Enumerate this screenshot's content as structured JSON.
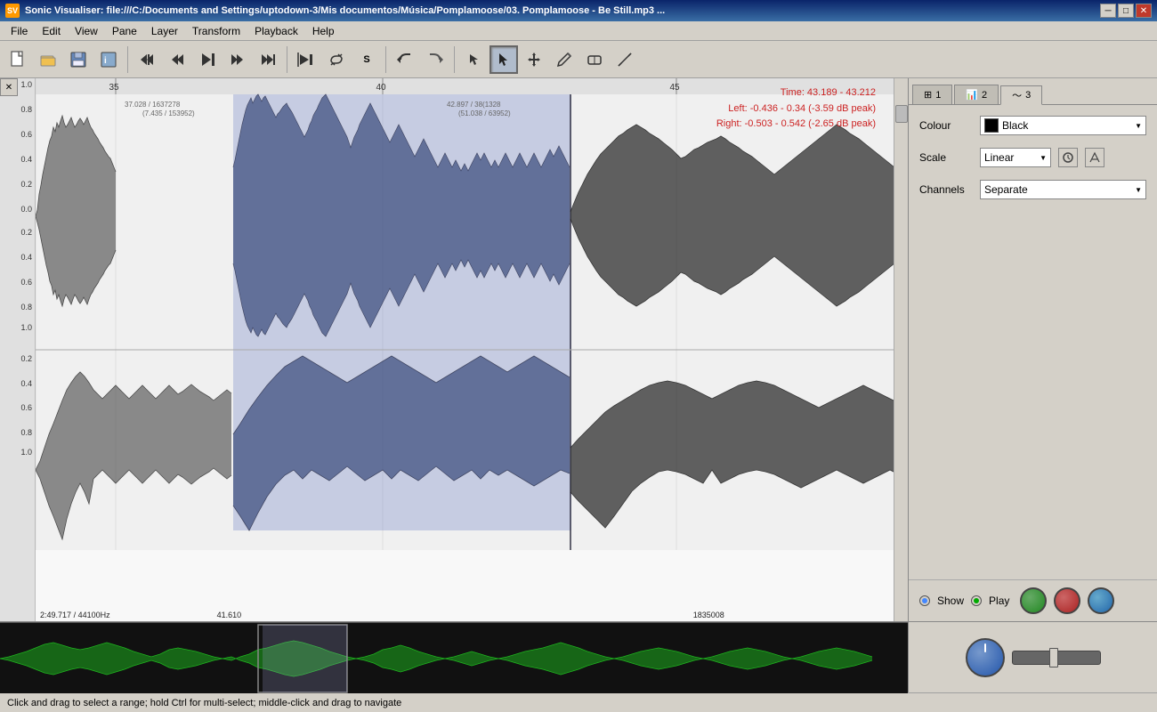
{
  "titleBar": {
    "icon": "SV",
    "title": "Sonic Visualiser: file:///C:/Documents and Settings/uptodown-3/Mis documentos/Música/Pomplamoose/03. Pomplamoose - Be Still.mp3 ...",
    "controls": {
      "minimize": "─",
      "maximize": "□",
      "close": "✕"
    }
  },
  "menuBar": {
    "items": [
      "File",
      "Edit",
      "View",
      "Pane",
      "Layer",
      "Transform",
      "Playback",
      "Help"
    ]
  },
  "toolbar": {
    "buttons": [
      {
        "name": "new",
        "icon": "📄",
        "label": "New"
      },
      {
        "name": "open",
        "icon": "📂",
        "label": "Open"
      },
      {
        "name": "save",
        "icon": "💾",
        "label": "Save"
      },
      {
        "name": "import",
        "icon": "📥",
        "label": "Import"
      },
      {
        "name": "sep1"
      },
      {
        "name": "rewind-start",
        "icon": "⏮",
        "label": "Rewind to Start"
      },
      {
        "name": "rewind",
        "icon": "⏪",
        "label": "Rewind"
      },
      {
        "name": "play-pause",
        "icon": "⏯",
        "label": "Play/Pause"
      },
      {
        "name": "fast-forward",
        "icon": "⏩",
        "label": "Fast Forward"
      },
      {
        "name": "forward-end",
        "icon": "⏭",
        "label": "Forward to End"
      },
      {
        "name": "sep2"
      },
      {
        "name": "play-selection",
        "icon": "▶|",
        "label": "Play Selection"
      },
      {
        "name": "loop",
        "icon": "🔁",
        "label": "Loop"
      },
      {
        "name": "solo",
        "icon": "S",
        "label": "Solo"
      },
      {
        "name": "sep3"
      },
      {
        "name": "undo",
        "icon": "↩",
        "label": "Undo"
      },
      {
        "name": "redo",
        "icon": "↪",
        "label": "Redo"
      },
      {
        "name": "sep4"
      },
      {
        "name": "navigate",
        "icon": "✋",
        "label": "Navigate"
      },
      {
        "name": "select",
        "icon": "↖",
        "label": "Select",
        "active": true
      },
      {
        "name": "move",
        "icon": "✚",
        "label": "Move"
      },
      {
        "name": "draw",
        "icon": "✏",
        "label": "Draw"
      },
      {
        "name": "erase",
        "icon": "◻",
        "label": "Erase"
      },
      {
        "name": "measure",
        "icon": "⚖",
        "label": "Measure"
      }
    ]
  },
  "waveform": {
    "timeInfo": {
      "time": "Time: 43.189 - 43.212",
      "left": "Left: -0.436 - 0.34 (-3.59 dB peak)",
      "right": "Right: -0.503 - 0.542 (-2.65 dB peak)"
    },
    "timeMarkers": [
      "35",
      "40",
      "45"
    ],
    "yLabels": [
      "1.0",
      "0.8",
      "0.6",
      "0.4",
      "0.2",
      "0.0",
      "0.2",
      "0.4",
      "0.6",
      "0.8",
      "1.0",
      "0.2",
      "0.4",
      "0.6",
      "0.8",
      "1.0"
    ],
    "bottomInfo": {
      "time": "2:49.717",
      "sampleRate": "44100Hz",
      "position": "41.610",
      "samples": "1835008"
    }
  },
  "rightPanel": {
    "tabs": [
      {
        "id": "tab1",
        "icon": "⊞",
        "label": "1"
      },
      {
        "id": "tab2",
        "icon": "📊",
        "label": "2"
      },
      {
        "id": "tab3",
        "icon": "〜",
        "label": "3",
        "active": true
      }
    ],
    "colour": {
      "label": "Colour",
      "value": "Black",
      "swatch": "#000000"
    },
    "scale": {
      "label": "Scale",
      "value": "Linear"
    },
    "channels": {
      "label": "Channels",
      "value": "Separate"
    },
    "show": {
      "label": "Show"
    },
    "play": {
      "label": "Play"
    }
  },
  "statusBar": {
    "text": "Click and drag to select a range; hold Ctrl for multi-select; middle-click and drag to navigate"
  }
}
